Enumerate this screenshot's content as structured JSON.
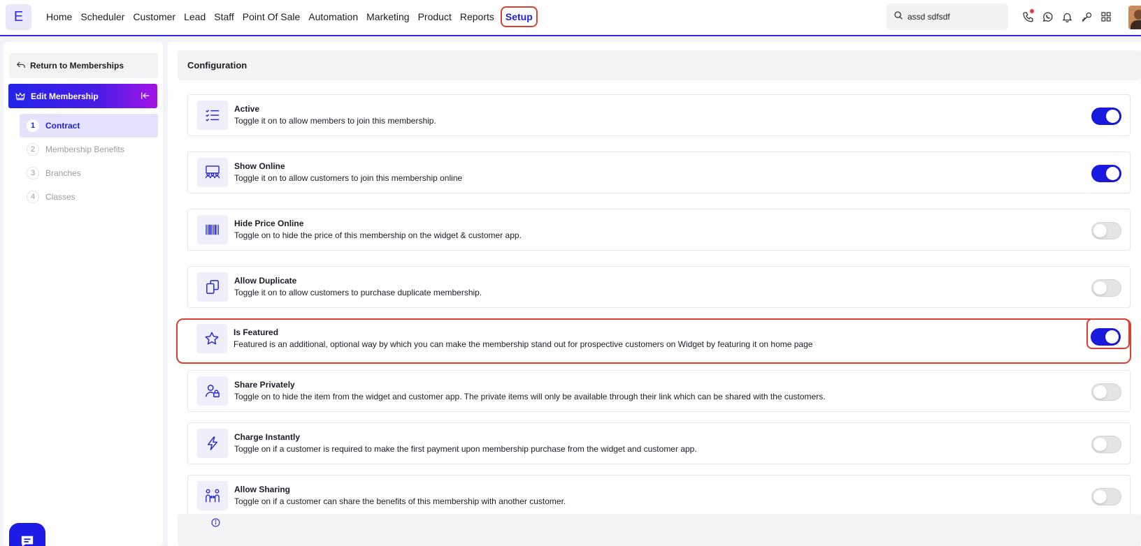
{
  "app": {
    "logo_letter": "E",
    "accent_color": "#1a1adf",
    "highlight_color": "#d9402f"
  },
  "nav": {
    "items": [
      "Home",
      "Scheduler",
      "Customer",
      "Lead",
      "Staff",
      "Point Of Sale",
      "Automation",
      "Marketing",
      "Product",
      "Reports",
      "Setup"
    ],
    "active": "Setup",
    "search_value": "assd sdfsdf",
    "icons": [
      "phone-icon",
      "whatsapp-icon",
      "bell-icon",
      "key-icon",
      "apps-grid-icon"
    ]
  },
  "sidebar": {
    "return_label": "Return to Memberships",
    "section_title": "Edit Membership",
    "steps": [
      {
        "num": "1",
        "label": "Contract",
        "active": true
      },
      {
        "num": "2",
        "label": "Membership Benefits",
        "active": false
      },
      {
        "num": "3",
        "label": "Branches",
        "active": false
      },
      {
        "num": "4",
        "label": "Classes",
        "active": false
      }
    ]
  },
  "main": {
    "section_title": "Configuration",
    "settings": [
      {
        "icon": "checklist-icon",
        "title": "Active",
        "description": "Toggle it on to allow members to join this membership.",
        "enabled": true
      },
      {
        "icon": "online-group-icon",
        "title": "Show Online",
        "description": "Toggle it on to allow customers to join this membership online",
        "enabled": true
      },
      {
        "icon": "barcode-icon",
        "title": "Hide Price Online",
        "description": "Toggle on to hide the price of this membership on the widget & customer app.",
        "enabled": false
      },
      {
        "icon": "duplicate-icon",
        "title": "Allow Duplicate",
        "description": "Toggle it on to allow customers to purchase duplicate membership.",
        "enabled": false
      },
      {
        "icon": "star-icon",
        "title": "Is Featured",
        "description": "Featured is an additional, optional way by which you can make the membership stand out for prospective customers on Widget by featuring it on home page",
        "enabled": true
      },
      {
        "icon": "user-lock-icon",
        "title": "Share Privately",
        "description": "Toggle on to hide the item from the widget and customer app. The private items will only be available through their link which can be shared with the customers.",
        "enabled": false
      },
      {
        "icon": "lightning-icon",
        "title": "Charge Instantly",
        "description": "Toggle on if a customer is required to make the first payment upon membership purchase from the widget and customer app.",
        "enabled": false
      },
      {
        "icon": "sharing-people-icon",
        "title": "Allow Sharing",
        "description": "Toggle on if a customer can share the benefits of this membership with another customer.",
        "enabled": false
      }
    ]
  }
}
